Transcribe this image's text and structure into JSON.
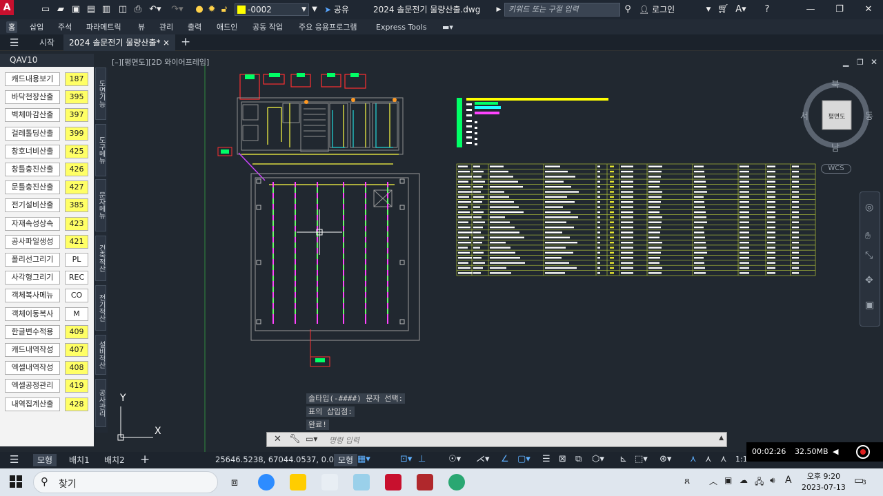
{
  "titlebar": {
    "app_logo": "A",
    "layer_value": "-0002",
    "share_label": "공유",
    "doc_title": "2024 솔문전기 물량산출.dwg",
    "search_placeholder": "키워드 또는 구절 입력",
    "login_label": "로그인",
    "layer_color": "#ffff00"
  },
  "ribbon": {
    "tabs": [
      "홈",
      "삽입",
      "주석",
      "파라메트릭",
      "뷰",
      "관리",
      "출력",
      "애드인",
      "공동 작업",
      "주요 응용프로그램",
      "Express Tools"
    ]
  },
  "doctabs": {
    "start": "시작",
    "file": "2024 솔문전기 물량산출*",
    "close": "×",
    "new": "+"
  },
  "palette": {
    "title": "QAV10",
    "rows": [
      {
        "label": "캐드내용보기",
        "btn": "187",
        "style": "y"
      },
      {
        "label": "바닥천장산출",
        "btn": "395",
        "style": "y"
      },
      {
        "label": "벽체마감산출",
        "btn": "397",
        "style": "y"
      },
      {
        "label": "걸레톨딩산출",
        "btn": "399",
        "style": "y"
      },
      {
        "label": "창호너비산출",
        "btn": "425",
        "style": "y"
      },
      {
        "label": "창틀충진산출",
        "btn": "426",
        "style": "y"
      },
      {
        "label": "문틀충진산출",
        "btn": "427",
        "style": "y"
      },
      {
        "label": "전기설비산출",
        "btn": "385",
        "style": "y"
      },
      {
        "label": "자재속성상속",
        "btn": "423",
        "style": "y"
      },
      {
        "label": "공사파일생성",
        "btn": "421",
        "style": "y"
      },
      {
        "label": "폴리선그리기",
        "btn": "PL",
        "style": "w"
      },
      {
        "label": "사각형그리기",
        "btn": "REC",
        "style": "w"
      },
      {
        "label": "객체복사메뉴",
        "btn": "CO",
        "style": "w"
      },
      {
        "label": "객체이동복사",
        "btn": "M",
        "style": "w"
      },
      {
        "label": "한글변수적용",
        "btn": "409",
        "style": "y"
      },
      {
        "label": "캐드내역작성",
        "btn": "407",
        "style": "y"
      },
      {
        "label": "엑셀내역작성",
        "btn": "408",
        "style": "y"
      },
      {
        "label": "엑셀공정관리",
        "btn": "419",
        "style": "y"
      },
      {
        "label": "내역집계산출",
        "btn": "428",
        "style": "y"
      }
    ],
    "vtabs": [
      "도면기능",
      "도구메뉴",
      "문자메뉴",
      "건축적산",
      "전기적산",
      "설비적산",
      "공사관리"
    ]
  },
  "canvas": {
    "view_label": "[–][평면도][2D 와이어프레임]",
    "viewcube": {
      "north": "북",
      "south": "남",
      "east": "동",
      "west": "서",
      "face": "평면도"
    },
    "wcs": "WCS",
    "ucs_x": "X",
    "ucs_y": "Y"
  },
  "command": {
    "history": [
      "솔타입(-####) 문자 선택:",
      "표의 삽입점:",
      "완료!"
    ],
    "input_placeholder": "명령 입력"
  },
  "statusbar": {
    "tabs": [
      "모형",
      "배치1",
      "배치2"
    ],
    "coords": "25646.5238, 67044.0537, 0.0000",
    "model_btn": "모형",
    "scale": "1:1"
  },
  "recorder": {
    "time": "00:02:26",
    "size": "32.50MB"
  },
  "taskbar": {
    "search_label": "찾기",
    "time": "오후 9:20",
    "date": "2023-07-13",
    "notification_count": "3"
  }
}
